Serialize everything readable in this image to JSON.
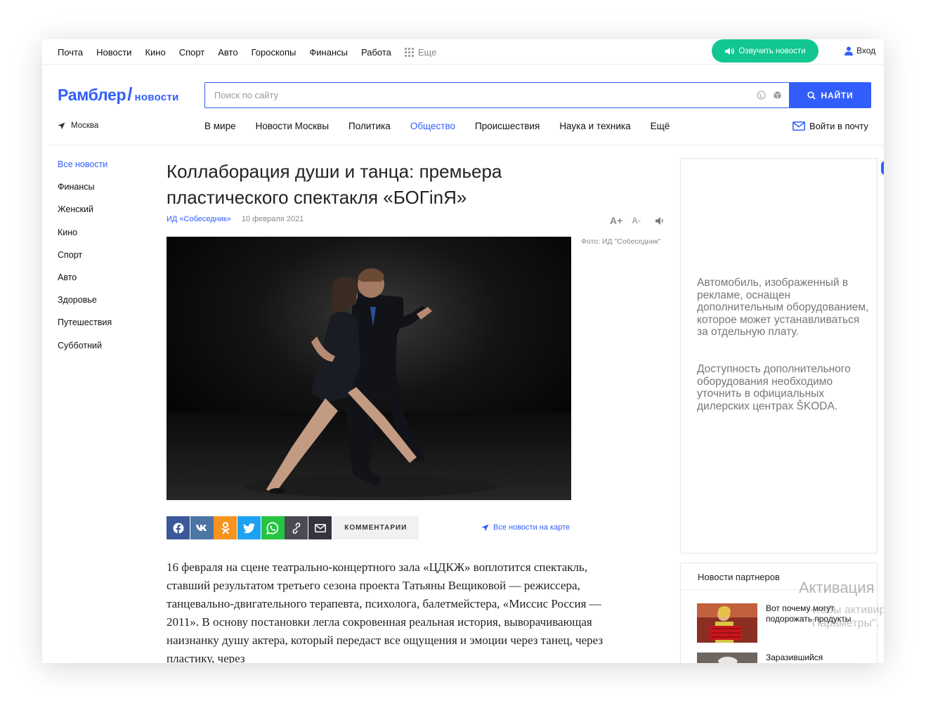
{
  "topbar": {
    "nav": [
      "Почта",
      "Новости",
      "Кино",
      "Спорт",
      "Авто",
      "Гороскопы",
      "Финансы",
      "Работа"
    ],
    "more_label": "Еще",
    "voice_button": "Озвучить новости",
    "login_label": "Вход"
  },
  "header": {
    "logo_main": "Рамблер",
    "logo_slash": "/",
    "logo_sub": "новости",
    "search_placeholder": "Поиск по сайту",
    "search_button": "НАЙТИ",
    "city": "Москва",
    "categories": [
      "В мире",
      "Новости Москвы",
      "Политика",
      "Общество",
      "Происшествия",
      "Наука и техника",
      "Ещё"
    ],
    "active_category": "Общество",
    "mail_link": "Войти в почту"
  },
  "sidebar": {
    "items": [
      "Все новости",
      "Финансы",
      "Женский",
      "Кино",
      "Спорт",
      "Авто",
      "Здоровье",
      "Путешествия",
      "Субботний"
    ],
    "active": "Все новости"
  },
  "article": {
    "title": "Коллаборация души и танца: премьера пластического спектакля «БОГinЯ»",
    "source": "ИД «Собеседник»",
    "date": "10 февраля 2021",
    "font_increase": "A+",
    "font_decrease": "A-",
    "photo_credit": "Фото: ИД \"Собеседник\"",
    "share_icons": [
      "facebook-icon",
      "vk-icon",
      "odnoklassniki-icon",
      "twitter-icon",
      "whatsapp-icon",
      "link-icon",
      "mail-icon"
    ],
    "comments_label": "КОММЕНТАРИИ",
    "map_link": "Все новости на карте",
    "body": "16 февраля на сцене театрально-концертного зала «ЦДКЖ» воплотится спектакль, ставший результатом третьего сезона проекта Татьяны Вещиковой — режиссера, танцевально-двигательного терапевта, психолога, балетмейстера, «Миссис Россия — 2011». В основу постановки легла сокровенная реальная история, выворачивающая наизнанку душу актера, который передаст все ощущения и эмоции через танец, через пластику, через"
  },
  "ad": {
    "paragraph_1": "Автомобиль, изображенный в рекламе, оснащен дополнительным оборудованием, которое может устанавливаться за отдельную плату.",
    "paragraph_2": "Доступность дополнительного оборудования необходимо уточнить в официальных дилерских центрах ŠKODA."
  },
  "partners": {
    "heading": "Новости партнеров",
    "items": [
      "Вот почему могут подорожать продукты",
      "Заразившийся"
    ]
  },
  "watermark": {
    "line1": "Активация",
    "line2": "Чтобы активир",
    "line3": "\"Параметры\"."
  },
  "colors": {
    "accent": "#315efb",
    "voice_green": "#12c691"
  }
}
